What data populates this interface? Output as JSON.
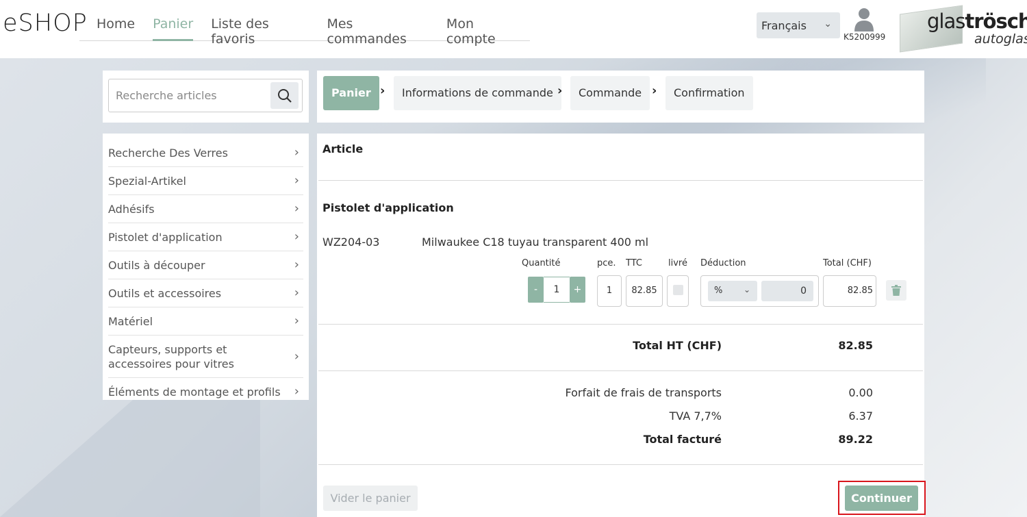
{
  "app": {
    "logo": "eSHOP",
    "brand_main_light": "glas",
    "brand_main_bold": "trösch",
    "brand_sub": "autoglas"
  },
  "nav": {
    "items": [
      "Home",
      "Panier",
      "Liste des favoris",
      "Mes commandes",
      "Mon compte"
    ],
    "active": "Panier"
  },
  "language": {
    "selected": "Français"
  },
  "user": {
    "id": "K5200999"
  },
  "search": {
    "placeholder": "Recherche articles"
  },
  "categories": [
    "Recherche Des Verres",
    "Spezial-Artikel",
    "Adhésifs",
    "Pistolet d'application",
    "Outils à découper",
    "Outils et accessoires",
    "Matériel",
    "Capteurs, supports et accessoires pour vitres",
    "Éléments de montage et profils"
  ],
  "steps": [
    "Panier",
    "Informations de commande",
    "Commande",
    "Confirmation"
  ],
  "cart": {
    "header": "Article",
    "group": "Pistolet d'application",
    "item": {
      "code": "WZ204-03",
      "name": "Milwaukee C18 tuyau transparent 400 ml",
      "labels": {
        "qty": "Quantité",
        "pce": "pce.",
        "ttc": "TTC",
        "delivered": "livré",
        "deduction": "Déduction",
        "total": "Total (CHF)"
      },
      "qty_minus": "-",
      "qty": "1",
      "qty_plus": "+",
      "pce": "1",
      "ttc": "82.85",
      "deduction_type": "%",
      "deduction_value": "0",
      "total": "82.85"
    },
    "totals": {
      "ht_label": "Total HT (CHF)",
      "ht_value": "82.85",
      "shipping_label": "Forfait de frais de transports",
      "shipping_value": "0.00",
      "tva_label": "TVA 7,7%",
      "tva_value": "6.37",
      "billed_label": "Total facturé",
      "billed_value": "89.22"
    },
    "buttons": {
      "clear": "Vider le panier",
      "continue": "Continuer"
    }
  }
}
